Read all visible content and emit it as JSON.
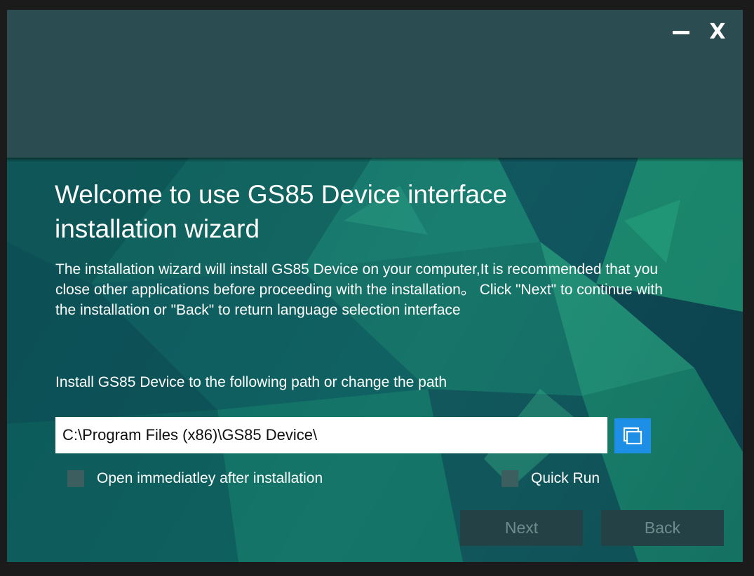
{
  "window": {
    "minimize_label": "−",
    "close_label": "X"
  },
  "content": {
    "heading": "Welcome to use GS85 Device interface installation wizard",
    "description": "The installation wizard will install GS85 Device on your computer,It is recommended that you close other applications before proceeding with the installation。 Click \"Next\" to continue with the installation or \"Back\" to return language selection interface",
    "path_label": "Install GS85 Device to the following path or change the path",
    "install_path": "C:\\Program Files (x86)\\GS85 Device\\",
    "browse_icon": "folder-browse-icon",
    "open_after_label": "Open immediatley after installation",
    "open_after_checked": false,
    "quick_run_label": "Quick Run",
    "quick_run_checked": false,
    "next_label": "Next",
    "back_label": "Back"
  },
  "colors": {
    "titlebar": "#2b4d52",
    "browse_button": "#1e8fe6",
    "button_bg": "#244246",
    "button_text": "#6f8b8d"
  }
}
